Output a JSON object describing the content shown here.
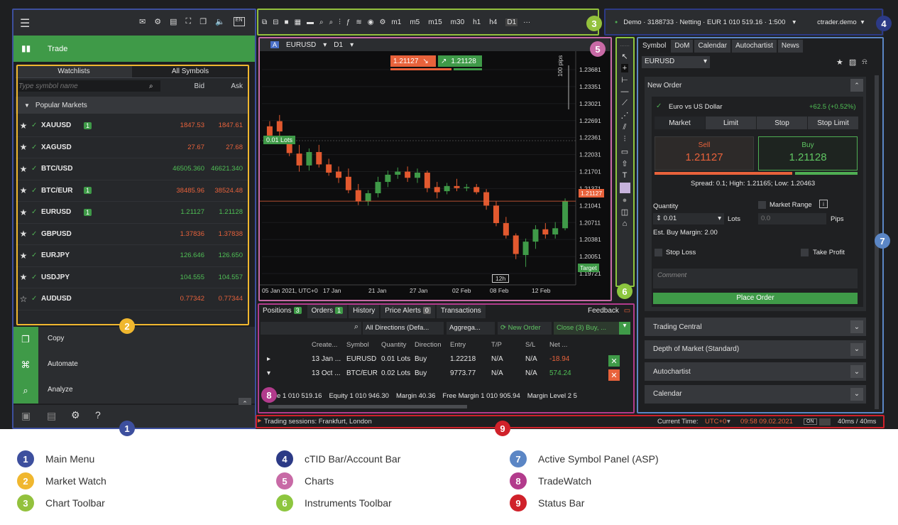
{
  "colors": {
    "main_menu": "#3d4f9e",
    "market_watch": "#f0b72f",
    "chart_toolbar": "#93c13d",
    "account_bar": "#2c3a86",
    "charts": "#c86aa6",
    "instruments": "#8dc63f",
    "asp": "#5b86c5",
    "tradewatch": "#b23b8c",
    "status": "#d0212a"
  },
  "zones": [
    {
      "num": "1",
      "label": "Main Menu"
    },
    {
      "num": "2",
      "label": "Market Watch"
    },
    {
      "num": "3",
      "label": "Chart Toolbar"
    },
    {
      "num": "4",
      "label": "cTID Bar/Account Bar"
    },
    {
      "num": "5",
      "label": "Charts"
    },
    {
      "num": "6",
      "label": "Instruments Toolbar"
    },
    {
      "num": "7",
      "label": "Active Symbol Panel (ASP)"
    },
    {
      "num": "8",
      "label": "TradeWatch"
    },
    {
      "num": "9",
      "label": "Status Bar"
    }
  ],
  "left": {
    "trade": "Trade",
    "mw_tabs": [
      "Watchlists",
      "All Symbols"
    ],
    "search_placeholder": "Type symbol name",
    "bid": "Bid",
    "ask": "Ask",
    "popular": "Popular Markets",
    "symbols": [
      {
        "star": "★",
        "name": "XAUUSD",
        "count": "1",
        "bid": "1847.53",
        "ask": "1847.61",
        "color": "red"
      },
      {
        "star": "★",
        "name": "XAGUSD",
        "count": "",
        "bid": "27.67",
        "ask": "27.68",
        "color": "red"
      },
      {
        "star": "★",
        "name": "BTC/USD",
        "count": "",
        "bid": "46505.360",
        "ask": "46621.340",
        "color": "green"
      },
      {
        "star": "★",
        "name": "BTC/EUR",
        "count": "1",
        "bid": "38485.96",
        "ask": "38524.48",
        "color": "red"
      },
      {
        "star": "★",
        "name": "EURUSD",
        "count": "1",
        "bid": "1.21127",
        "ask": "1.21128",
        "color": "green"
      },
      {
        "star": "★",
        "name": "GBPUSD",
        "count": "",
        "bid": "1.37836",
        "ask": "1.37838",
        "color": "red"
      },
      {
        "star": "★",
        "name": "EURJPY",
        "count": "",
        "bid": "126.646",
        "ask": "126.650",
        "color": "green"
      },
      {
        "star": "★",
        "name": "USDJPY",
        "count": "",
        "bid": "104.555",
        "ask": "104.557",
        "color": "green"
      },
      {
        "star": "☆",
        "name": "AUDUSD",
        "count": "",
        "bid": "0.77342",
        "ask": "0.77344",
        "color": "red"
      }
    ],
    "copy": "Copy",
    "automate": "Automate",
    "analyze": "Analyze"
  },
  "toolbar": {
    "timeframes": [
      "m1",
      "m5",
      "m15",
      "m30",
      "h1",
      "h4",
      "D1"
    ]
  },
  "account": {
    "text": "Demo · 3188733 · Netting · EUR 1 010 519.16 · 1:500",
    "ctid": "ctrader.demo"
  },
  "chart": {
    "symbol": "EURUSD",
    "timeframe": "D1",
    "sell_price": "1.21127",
    "buy_price": "1.21128",
    "lots_label": "0.01 Lots",
    "pips_label": "100 pips",
    "target_label": "Target",
    "current_price_label": "1.21127",
    "y_ticks": [
      "1.23681",
      "1.23351",
      "1.23021",
      "1.22691",
      "1.22361",
      "1.22031",
      "1.21701",
      "1.21371",
      "1.21041",
      "1.20711",
      "1.20381",
      "1.20051",
      "1.19721"
    ],
    "x_ticks": [
      "05 Jan 2021, UTC+0",
      "17 Jan",
      "21 Jan",
      "27 Jan",
      "02 Feb",
      "08 Feb",
      "12 Feb"
    ],
    "time_label": "12h",
    "candles": [
      {
        "o": 1.2258,
        "h": 1.2268,
        "l": 1.2232,
        "c": 1.224
      },
      {
        "o": 1.2268,
        "h": 1.228,
        "l": 1.2235,
        "c": 1.2248
      },
      {
        "o": 1.2232,
        "h": 1.224,
        "l": 1.22,
        "c": 1.2206
      },
      {
        "o": 1.2205,
        "h": 1.2222,
        "l": 1.217,
        "c": 1.2182
      },
      {
        "o": 1.2182,
        "h": 1.2215,
        "l": 1.2172,
        "c": 1.2208
      },
      {
        "o": 1.2208,
        "h": 1.2222,
        "l": 1.2178,
        "c": 1.2184
      },
      {
        "o": 1.2184,
        "h": 1.2195,
        "l": 1.2162,
        "c": 1.2168
      },
      {
        "o": 1.217,
        "h": 1.218,
        "l": 1.2148,
        "c": 1.2158
      },
      {
        "o": 1.216,
        "h": 1.2176,
        "l": 1.2128,
        "c": 1.2134
      },
      {
        "o": 1.2134,
        "h": 1.2146,
        "l": 1.2105,
        "c": 1.2112
      },
      {
        "o": 1.2112,
        "h": 1.2134,
        "l": 1.2104,
        "c": 1.2128
      },
      {
        "o": 1.2128,
        "h": 1.216,
        "l": 1.212,
        "c": 1.215
      },
      {
        "o": 1.215,
        "h": 1.2172,
        "l": 1.214,
        "c": 1.2164
      },
      {
        "o": 1.2164,
        "h": 1.2178,
        "l": 1.2156,
        "c": 1.217
      },
      {
        "o": 1.217,
        "h": 1.218,
        "l": 1.215,
        "c": 1.2158
      },
      {
        "o": 1.2158,
        "h": 1.2176,
        "l": 1.2148,
        "c": 1.2168
      },
      {
        "o": 1.2168,
        "h": 1.2172,
        "l": 1.213,
        "c": 1.2138
      },
      {
        "o": 1.214,
        "h": 1.215,
        "l": 1.2118,
        "c": 1.213
      },
      {
        "o": 1.2132,
        "h": 1.2148,
        "l": 1.2126,
        "c": 1.2142
      },
      {
        "o": 1.2142,
        "h": 1.2156,
        "l": 1.2132,
        "c": 1.2138
      },
      {
        "o": 1.2138,
        "h": 1.2146,
        "l": 1.2132,
        "c": 1.214
      },
      {
        "o": 1.214,
        "h": 1.2146,
        "l": 1.2126,
        "c": 1.213
      },
      {
        "o": 1.213,
        "h": 1.2136,
        "l": 1.2096,
        "c": 1.2104
      },
      {
        "o": 1.2104,
        "h": 1.2112,
        "l": 1.2064,
        "c": 1.207
      },
      {
        "o": 1.207,
        "h": 1.2082,
        "l": 1.204,
        "c": 1.2046
      },
      {
        "o": 1.2046,
        "h": 1.205,
        "l": 1.2,
        "c": 1.201
      },
      {
        "o": 1.2008,
        "h": 1.204,
        "l": 1.1985,
        "c": 1.2034
      },
      {
        "o": 1.2034,
        "h": 1.2066,
        "l": 1.202,
        "c": 1.2058
      },
      {
        "o": 1.2058,
        "h": 1.207,
        "l": 1.204,
        "c": 1.2048
      },
      {
        "o": 1.2048,
        "h": 1.2072,
        "l": 1.204,
        "c": 1.206
      },
      {
        "o": 1.206,
        "h": 1.2118,
        "l": 1.2056,
        "c": 1.2112
      }
    ]
  },
  "asp": {
    "tabs": [
      "Symbol",
      "DoM",
      "Calendar",
      "Autochartist",
      "News"
    ],
    "symbol": "EURUSD",
    "new_order": "New Order",
    "full_name": "Euro vs US Dollar",
    "change": "+62.5 (+0.52%)",
    "order_types": [
      "Market",
      "Limit",
      "Stop",
      "Stop Limit"
    ],
    "sell": "Sell",
    "buy": "Buy",
    "sell_price": "1.21127",
    "buy_price": "1.21128",
    "spread": "Spread: 0.1; High: 1.21165; Low: 1.20463",
    "quantity": "Quantity",
    "qty_value": "0.01",
    "lots": "Lots",
    "market_range": "Market Range",
    "range_value": "0.0",
    "pips": "Pips",
    "margin": "Est. Buy Margin: 2.00",
    "stop_loss": "Stop Loss",
    "take_profit": "Take Profit",
    "comment": "Comment",
    "place_order": "Place Order",
    "sections": [
      "Trading Central",
      "Depth of Market (Standard)",
      "Autochartist",
      "Calendar"
    ]
  },
  "tradewatch": {
    "tabs": [
      {
        "label": "Positions",
        "count": "3"
      },
      {
        "label": "Orders",
        "count": "1"
      },
      {
        "label": "History",
        "count": ""
      },
      {
        "label": "Price Alerts",
        "count": "0"
      },
      {
        "label": "Transactions",
        "count": ""
      }
    ],
    "feedback": "Feedback",
    "filter": "All Directions (Defa...",
    "aggregate": "Aggrega...",
    "new_order": "New Order",
    "close": "Close (3) Buy, ...",
    "columns": [
      "Create...",
      "Symbol",
      "Quantity",
      "Direction",
      "Entry",
      "T/P",
      "S/L",
      "Net ..."
    ],
    "rows": [
      {
        "expander": "▸",
        "created": "13 Jan ...",
        "symbol": "EURUSD",
        "qty": "0.01 Lots",
        "dir": "Buy",
        "entry": "1.22218",
        "tp": "N/A",
        "sl": "N/A",
        "net": "-18.94",
        "netcolor": "red",
        "btn": "✕",
        "btncolor": "#3f9a48"
      },
      {
        "expander": "▾",
        "created": "13 Oct ...",
        "symbol": "BTC/EUR",
        "qty": "0.02 Lots",
        "dir": "Buy",
        "entry": "9773.77",
        "tp": "N/A",
        "sl": "N/A",
        "net": "574.24",
        "netcolor": "green",
        "btn": "✕",
        "btncolor": "#e8623b"
      }
    ],
    "balance": "nce 1 010 519.16",
    "equity": "Equity 1 010 946.30",
    "margin": "Margin 40.36",
    "free_margin": "Free Margin 1 010 905.94",
    "margin_level": "Margin Level 2 5"
  },
  "status": {
    "sessions": "Trading sessions: Frankfurt, London",
    "current_time": "Current Time:",
    "tz": "UTC+0",
    "time": "09:58 09.02.2021",
    "on": "ON",
    "latency": "40ms / 40ms"
  }
}
